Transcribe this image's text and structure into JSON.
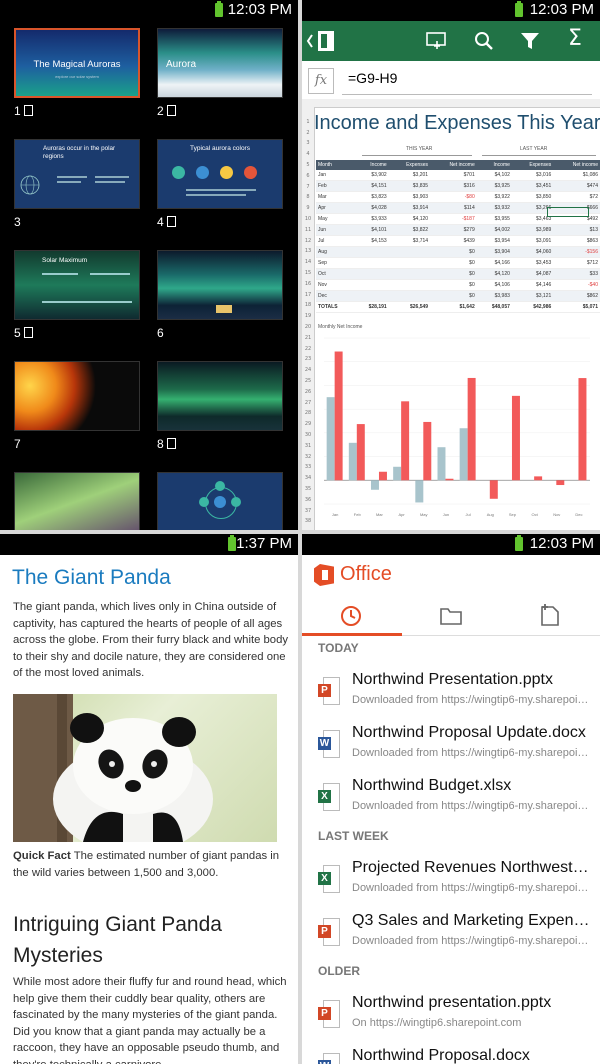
{
  "status": {
    "q1_time": "12:03 PM",
    "q2_time": "12:03 PM",
    "q3_time": "1:37 PM",
    "q4_time": "12:03 PM"
  },
  "slides": [
    {
      "num": "1",
      "title": "The Magical Auroras",
      "subtitle": "explore our solar system"
    },
    {
      "num": "2",
      "title": "Aurora"
    },
    {
      "num": "3",
      "title": "Auroras occur in the polar regions"
    },
    {
      "num": "4",
      "title": "Typical aurora colors"
    },
    {
      "num": "5",
      "title": "Solar Maximum"
    },
    {
      "num": "6"
    },
    {
      "num": "7"
    },
    {
      "num": "8"
    }
  ],
  "excel": {
    "formula": "=G9-H9",
    "fx": "fx",
    "title": "Income and Expenses This Year",
    "this_year": "THIS YEAR",
    "last_year": "LAST YEAR",
    "headers": [
      "Month",
      "Income",
      "Expenses",
      "Net income",
      "Income",
      "Expenses",
      "Net income"
    ],
    "rows": [
      [
        "Jan",
        "$3,902",
        "$3,201",
        "$701",
        "$4,102",
        "$3,016",
        "$1,086"
      ],
      [
        "Feb",
        "$4,151",
        "$3,835",
        "$316",
        "$3,925",
        "$3,451",
        "$474"
      ],
      [
        "Mar",
        "$3,823",
        "$3,903",
        "-$80",
        "$3,922",
        "$3,850",
        "$72"
      ],
      [
        "Apr",
        "$4,028",
        "$3,914",
        "$114",
        "$3,932",
        "$3,266",
        "$666"
      ],
      [
        "May",
        "$3,933",
        "$4,120",
        "-$187",
        "$3,955",
        "$3,463",
        "$492"
      ],
      [
        "Jun",
        "$4,101",
        "$3,822",
        "$279",
        "$4,002",
        "$3,989",
        "$13"
      ],
      [
        "Jul",
        "$4,153",
        "$3,714",
        "$439",
        "$3,954",
        "$3,091",
        "$863"
      ],
      [
        "Aug",
        "",
        "",
        "$0",
        "$3,904",
        "$4,060",
        "-$156"
      ],
      [
        "Sep",
        "",
        "",
        "$0",
        "$4,166",
        "$3,453",
        "$712"
      ],
      [
        "Oct",
        "",
        "",
        "$0",
        "$4,120",
        "$4,087",
        "$33"
      ],
      [
        "Nov",
        "",
        "",
        "$0",
        "$4,106",
        "$4,146",
        "-$40"
      ],
      [
        "Dec",
        "",
        "",
        "$0",
        "$3,983",
        "$3,121",
        "$862"
      ],
      [
        "TOTALS",
        "$28,191",
        "$26,549",
        "$1,642",
        "$48,057",
        "$42,986",
        "$5,071"
      ]
    ],
    "chart_title": "Monthly Net Income"
  },
  "chart_data": {
    "type": "bar",
    "title": "Monthly Net Income",
    "categories": [
      "Jan",
      "Feb",
      "Mar",
      "Apr",
      "May",
      "Jun",
      "Jul",
      "Aug",
      "Sep",
      "Oct",
      "Nov",
      "Dec"
    ],
    "series": [
      {
        "values": [
          701,
          316,
          -80,
          114,
          -187,
          279,
          439,
          0,
          0,
          0,
          0,
          0
        ]
      },
      {
        "values": [
          1086,
          474,
          72,
          666,
          492,
          13,
          863,
          -156,
          712,
          33,
          -40,
          862
        ]
      }
    ],
    "ylim": [
      -200,
      1200
    ],
    "colors": [
      "#a8c4cc",
      "#f25a5a"
    ]
  },
  "doc": {
    "title": "The Giant Panda",
    "intro": "The giant panda, which lives only in China outside of captivity, has captured the hearts of people of all ages across the globe. From their furry black and white body to their shy and docile nature, they are considered one of the most loved animals.",
    "fact_label": "Quick Fact",
    "fact_text": " The estimated number of giant pandas in the wild varies between 1,500 and 3,000.",
    "heading2": "Intriguing Giant Panda Mysteries",
    "para2": "While most adore their fluffy fur and round head, which help give them their cuddly bear quality, others are fascinated by the many mysteries of the giant panda. Did you know that a giant panda may actually be a raccoon, they have an opposable pseudo thumb, and they're technically a carnivore"
  },
  "office": {
    "app_title": "Office",
    "tabs": [
      {
        "icon": "clock-icon"
      },
      {
        "icon": "folder-icon"
      },
      {
        "icon": "new-document-icon"
      }
    ],
    "sections": [
      {
        "label": "TODAY"
      },
      {
        "label": "LAST WEEK"
      },
      {
        "label": "OLDER"
      }
    ],
    "files": [
      {
        "type": "P",
        "name": "Northwind Presentation.pptx",
        "sub": "Downloaded from https://wingtip6-my.sharepoint..."
      },
      {
        "type": "W",
        "name": "Northwind Proposal Update.docx",
        "sub": "Downloaded from https://wingtip6-my.sharepoint..."
      },
      {
        "type": "X",
        "name": "Northwind Budget.xlsx",
        "sub": "Downloaded from https://wingtip6-my.sharepoint..."
      },
      {
        "type": "X",
        "name": "Projected Revenues Northwest.xlsx",
        "sub": "Downloaded from https://wingtip6-my.sharepoint..."
      },
      {
        "type": "P",
        "name": "Q3 Sales and Marketing Expenses.pptx",
        "sub": "Downloaded from https://wingtip6-my.sharepoint..."
      },
      {
        "type": "P",
        "name": "Northwind presentation.pptx",
        "sub": "On https://wingtip6.sharepoint.com"
      },
      {
        "type": "W",
        "name": "Northwind Proposal.docx",
        "sub": ""
      }
    ],
    "colors": {
      "P": "#d24726",
      "W": "#2b579a",
      "X": "#217346",
      "accent": "#e44d26"
    }
  }
}
